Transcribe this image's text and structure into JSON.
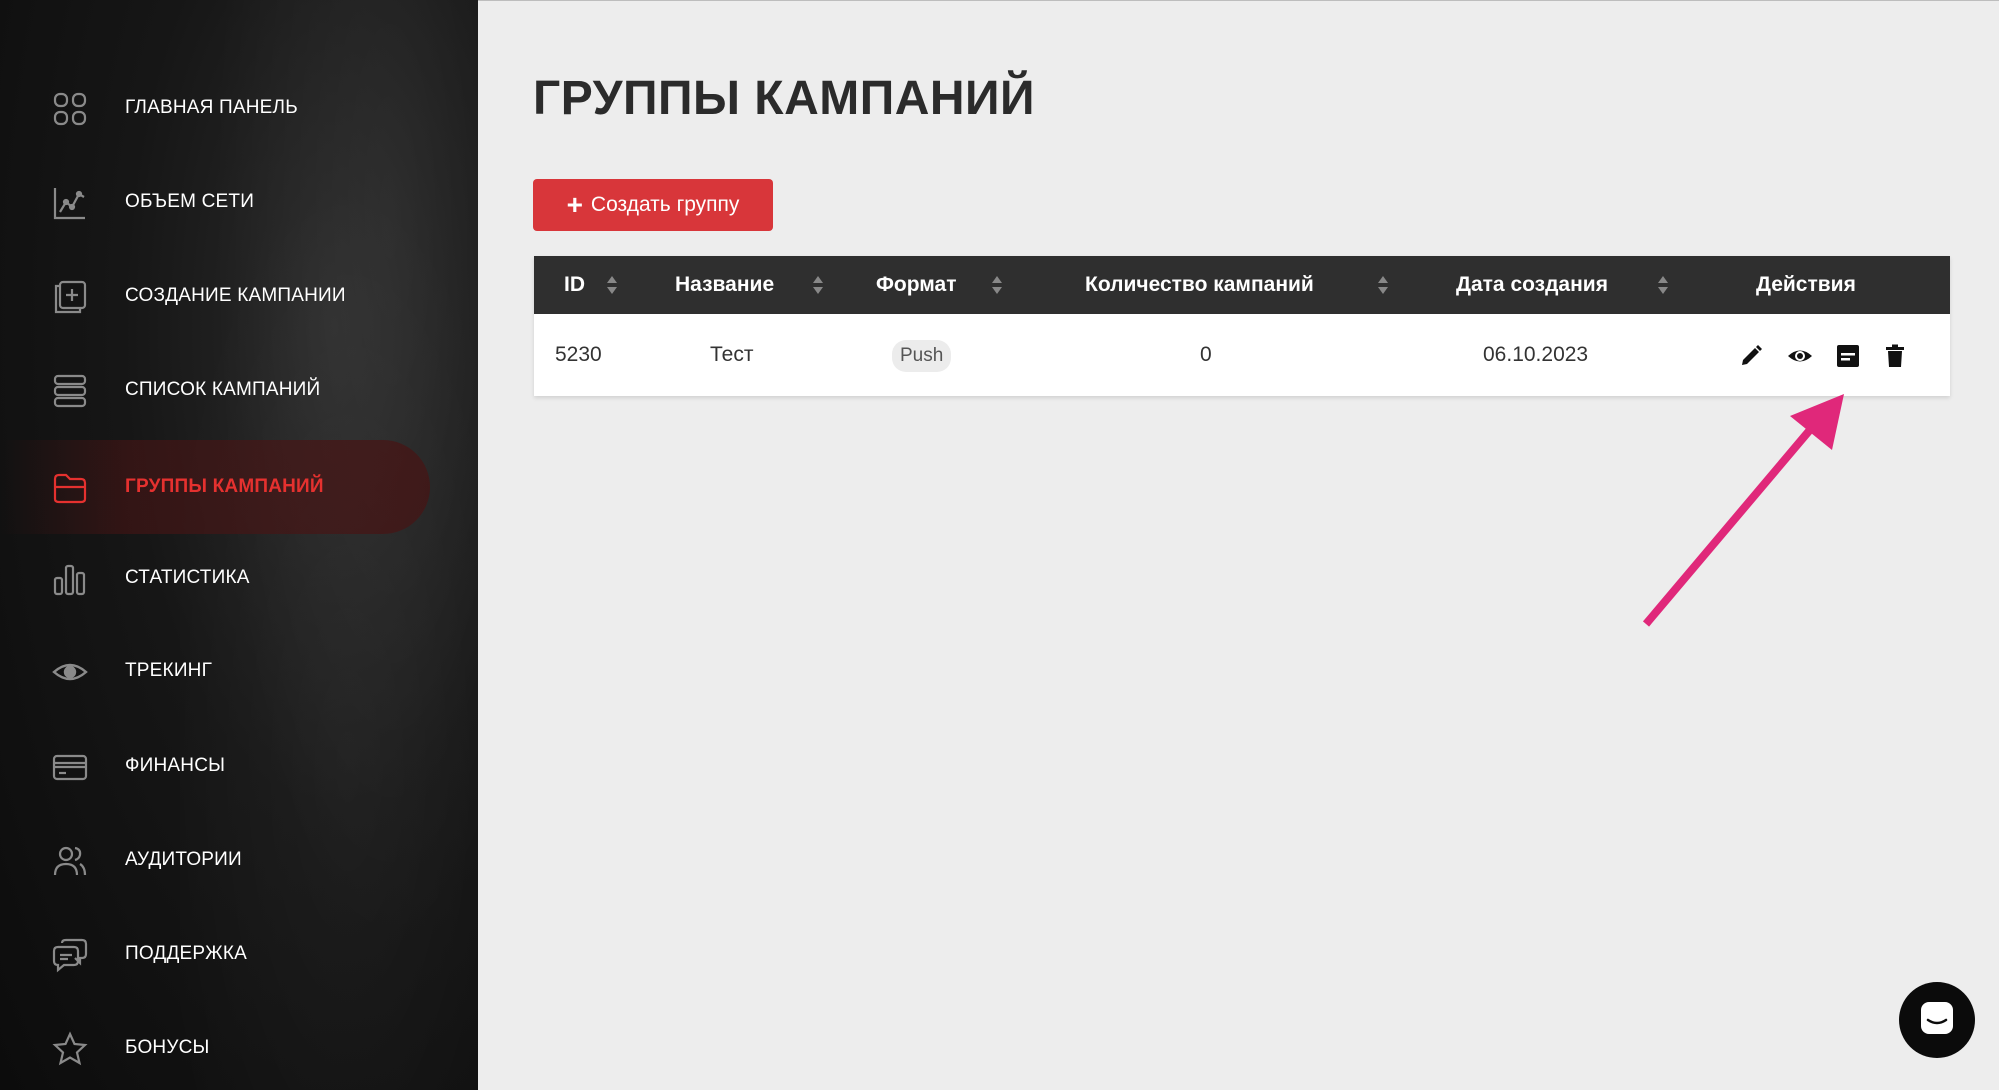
{
  "sidebar": {
    "items": [
      {
        "label": "ГЛАВНАЯ ПАНЕЛЬ",
        "icon": "dashboard-grid-icon"
      },
      {
        "label": "ОБЪЕМ СЕТИ",
        "icon": "line-chart-icon"
      },
      {
        "label": "СОЗДАНИЕ КАМПАНИИ",
        "icon": "add-document-icon"
      },
      {
        "label": "СПИСОК КАМПАНИЙ",
        "icon": "list-icon"
      },
      {
        "label": "ГРУППЫ КАМПАНИЙ",
        "icon": "folder-icon",
        "active": true
      },
      {
        "label": "СТАТИСТИКА",
        "icon": "bar-chart-icon"
      },
      {
        "label": "ТРЕКИНГ",
        "icon": "eye-icon"
      },
      {
        "label": "ФИНАНСЫ",
        "icon": "credit-card-icon"
      },
      {
        "label": "АУДИТОРИИ",
        "icon": "users-icon"
      },
      {
        "label": "ПОДДЕРЖКА",
        "icon": "chat-icon"
      },
      {
        "label": "БОНУСЫ",
        "icon": "star-icon"
      }
    ]
  },
  "main": {
    "title": "ГРУППЫ КАМПАНИЙ",
    "create_button": {
      "plus": "+",
      "label": "Создать группу"
    },
    "table": {
      "headers": [
        "ID",
        "Название",
        "Формат",
        "Количество кампаний",
        "Дата создания",
        "Действия"
      ],
      "rows": [
        {
          "id": "5230",
          "name": "Тест",
          "format": "Push",
          "count": "0",
          "date": "06.10.2023"
        }
      ]
    }
  },
  "colors": {
    "accent": "#d8363a",
    "active_nav": "#e5312f",
    "annotation_arrow": "#e0287a",
    "table_header": "#2f2f2f"
  }
}
